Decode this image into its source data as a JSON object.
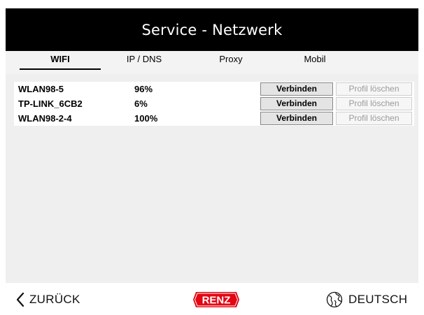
{
  "header": {
    "title": "Service - Netzwerk"
  },
  "tabs": [
    {
      "label": "WIFI",
      "active": true
    },
    {
      "label": "IP / DNS",
      "active": false
    },
    {
      "label": "Proxy",
      "active": false
    },
    {
      "label": "Mobil",
      "active": false
    }
  ],
  "networks": [
    {
      "ssid": "WLAN98-5",
      "signal": "96%",
      "connect_label": "Verbinden",
      "delete_label": "Profil löschen"
    },
    {
      "ssid": "TP-LINK_6CB2",
      "signal": "6%",
      "connect_label": "Verbinden",
      "delete_label": "Profil löschen"
    },
    {
      "ssid": "WLAN98-2-4",
      "signal": "100%",
      "connect_label": "Verbinden",
      "delete_label": "Profil löschen"
    }
  ],
  "footer": {
    "back_label": "ZURÜCK",
    "back_icon": "chevron-left-icon",
    "logo_text": "RENZ",
    "logo_color": "#e30613",
    "language_label": "DEUTSCH",
    "language_icon": "globe-icon"
  },
  "colors": {
    "titlebar": "#000000",
    "content_bg": "#efefef",
    "tab_bg": "#f3f3f3"
  }
}
